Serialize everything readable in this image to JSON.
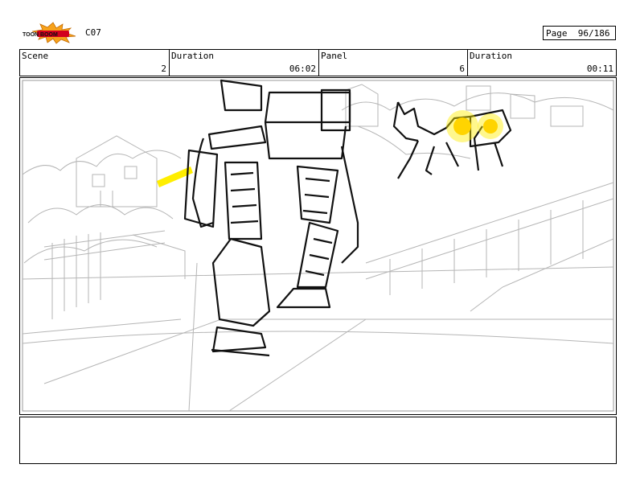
{
  "header": {
    "logo_text": "TOON BOOM",
    "code": "C07",
    "page_label": "Page",
    "page_value": "96/186"
  },
  "info_bar": {
    "scene": {
      "label": "Scene",
      "value": "2"
    },
    "scene_duration": {
      "label": "Duration",
      "value": "06:02"
    },
    "panel": {
      "label": "Panel",
      "value": "6"
    },
    "panel_duration": {
      "label": "Duration",
      "value": "00:11"
    }
  },
  "notes": {
    "text": ""
  },
  "colors": {
    "logo_burst": "#f7a21b",
    "logo_text_bg": "#d2001e",
    "highlight_yellow": "#ffee00",
    "sketch_gray": "#b5b5b5",
    "ink": "#111111"
  }
}
